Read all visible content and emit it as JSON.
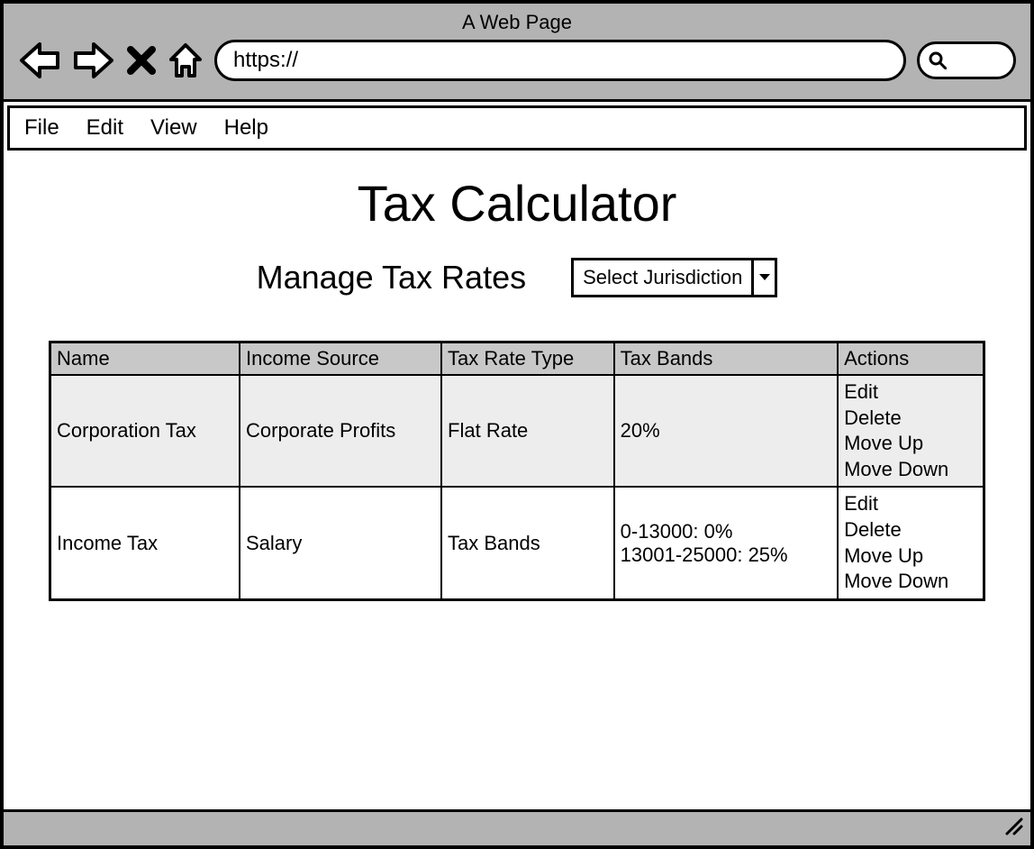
{
  "browser": {
    "page_label": "A Web Page",
    "url_prefix": "https://"
  },
  "menu": {
    "items": [
      "File",
      "Edit",
      "View",
      "Help"
    ]
  },
  "page": {
    "title": "Tax Calculator",
    "subtitle": "Manage Tax Rates",
    "jurisdiction_placeholder": "Select Jurisdiction"
  },
  "table": {
    "headers": [
      "Name",
      "Income Source",
      "Tax Rate Type",
      "Tax Bands",
      "Actions"
    ],
    "rows": [
      {
        "name": "Corporation Tax",
        "income_source": "Corporate Profits",
        "rate_type": "Flat Rate",
        "bands": "20%"
      },
      {
        "name": "Income Tax",
        "income_source": "Salary",
        "rate_type": "Tax Bands",
        "bands": "0-13000: 0%\n13001-25000: 25%"
      }
    ],
    "actions": [
      "Edit",
      "Delete",
      "Move Up",
      "Move Down"
    ]
  }
}
